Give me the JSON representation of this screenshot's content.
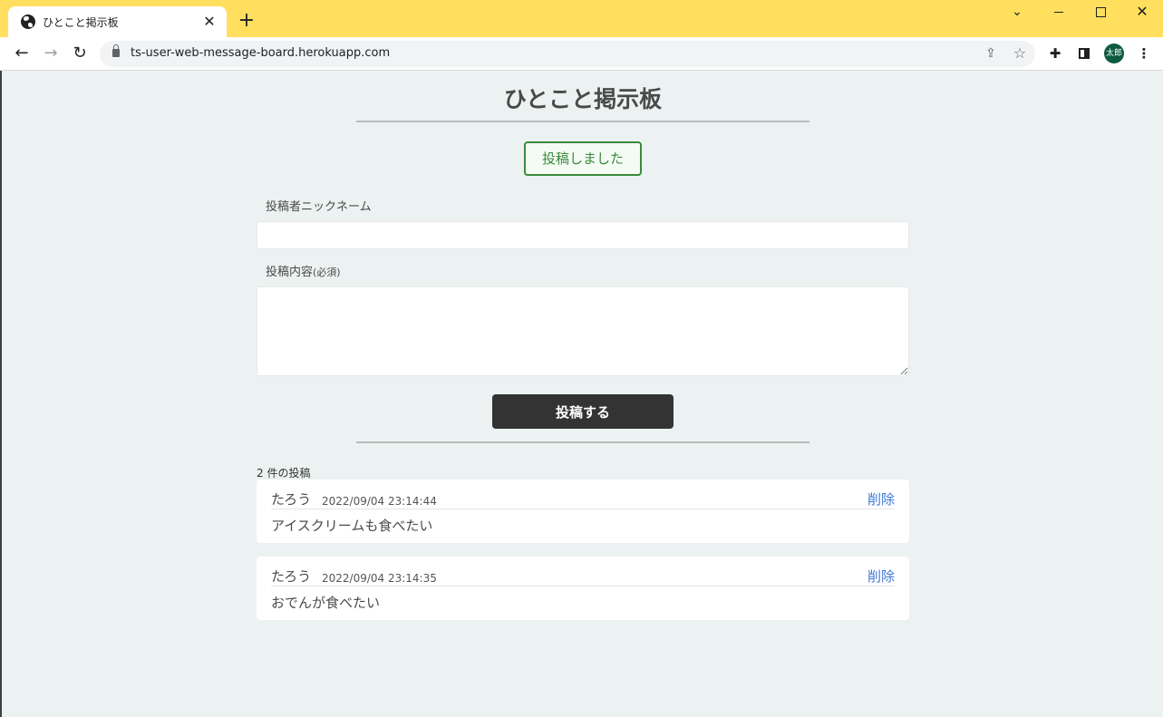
{
  "browser": {
    "tab_title": "ひとこと掲示板",
    "tab_close": "✕",
    "new_tab": "+",
    "url": "ts-user-web-message-board.herokuapp.com",
    "avatar_text": "太郎",
    "glyphs": {
      "back": "←",
      "forward": "→",
      "reload": "↻",
      "share": "⇪",
      "star": "☆",
      "puzzle": "✚",
      "menu": "⋮",
      "chevron": "⌄",
      "close": "✕"
    }
  },
  "page": {
    "title": "ひとこと掲示板",
    "flash_message": "投稿しました",
    "form": {
      "nickname_label": "投稿者ニックネーム",
      "nickname_value": "",
      "body_label": "投稿内容",
      "body_required": "(必須)",
      "body_value": "",
      "submit_label": "投稿する"
    },
    "post_count": "2 件の投稿",
    "posts": [
      {
        "name": "たろう",
        "date": "2022/09/04 23:14:44",
        "body": "アイスクリームも食べたい",
        "delete_label": "削除"
      },
      {
        "name": "たろう",
        "date": "2022/09/04 23:14:35",
        "body": "おでんが食べたい",
        "delete_label": "削除"
      }
    ]
  },
  "colors": {
    "titlebar": "#ffdf5d",
    "page_background": "#ecf2f1",
    "flash": "#3a8a3a",
    "submit_button": "#333333",
    "delete_link": "#3d77d6",
    "avatar": "#0b5b3e"
  }
}
